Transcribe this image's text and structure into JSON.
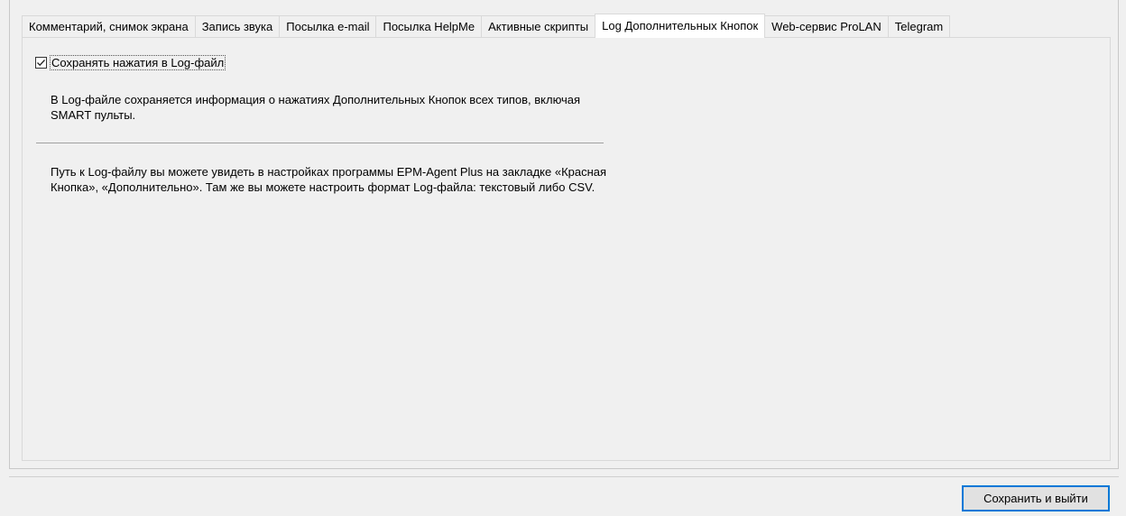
{
  "tabs": [
    {
      "label": "Комментарий, снимок экрана"
    },
    {
      "label": "Запись звука"
    },
    {
      "label": "Посылка e-mail"
    },
    {
      "label": "Посылка HelpMe"
    },
    {
      "label": "Активные скрипты"
    },
    {
      "label": "Log Дополнительных Кнопок",
      "active": true
    },
    {
      "label": "Web-сервис ProLAN"
    },
    {
      "label": "Telegram"
    }
  ],
  "panel": {
    "checkbox_label": "Сохранять нажатия в Log-файл",
    "checkbox_checked": true,
    "description_1": "В Log-файле сохраняется информация о нажатиях Дополнительных Кнопок всех типов, включая SMART пульты.",
    "description_2": "Путь к Log-файлу вы можете увидеть в настройках программы EPM-Agent Plus на закладке «Красная Кнопка», «Дополнительно». Там же вы можете настроить формат Log-файла: текстовый либо CSV."
  },
  "footer": {
    "save_exit_label": "Сохранить и выйти"
  },
  "colors": {
    "window_bg": "#f0f0f0",
    "active_tab_bg": "#ffffff",
    "focus_border": "#0078d7"
  }
}
